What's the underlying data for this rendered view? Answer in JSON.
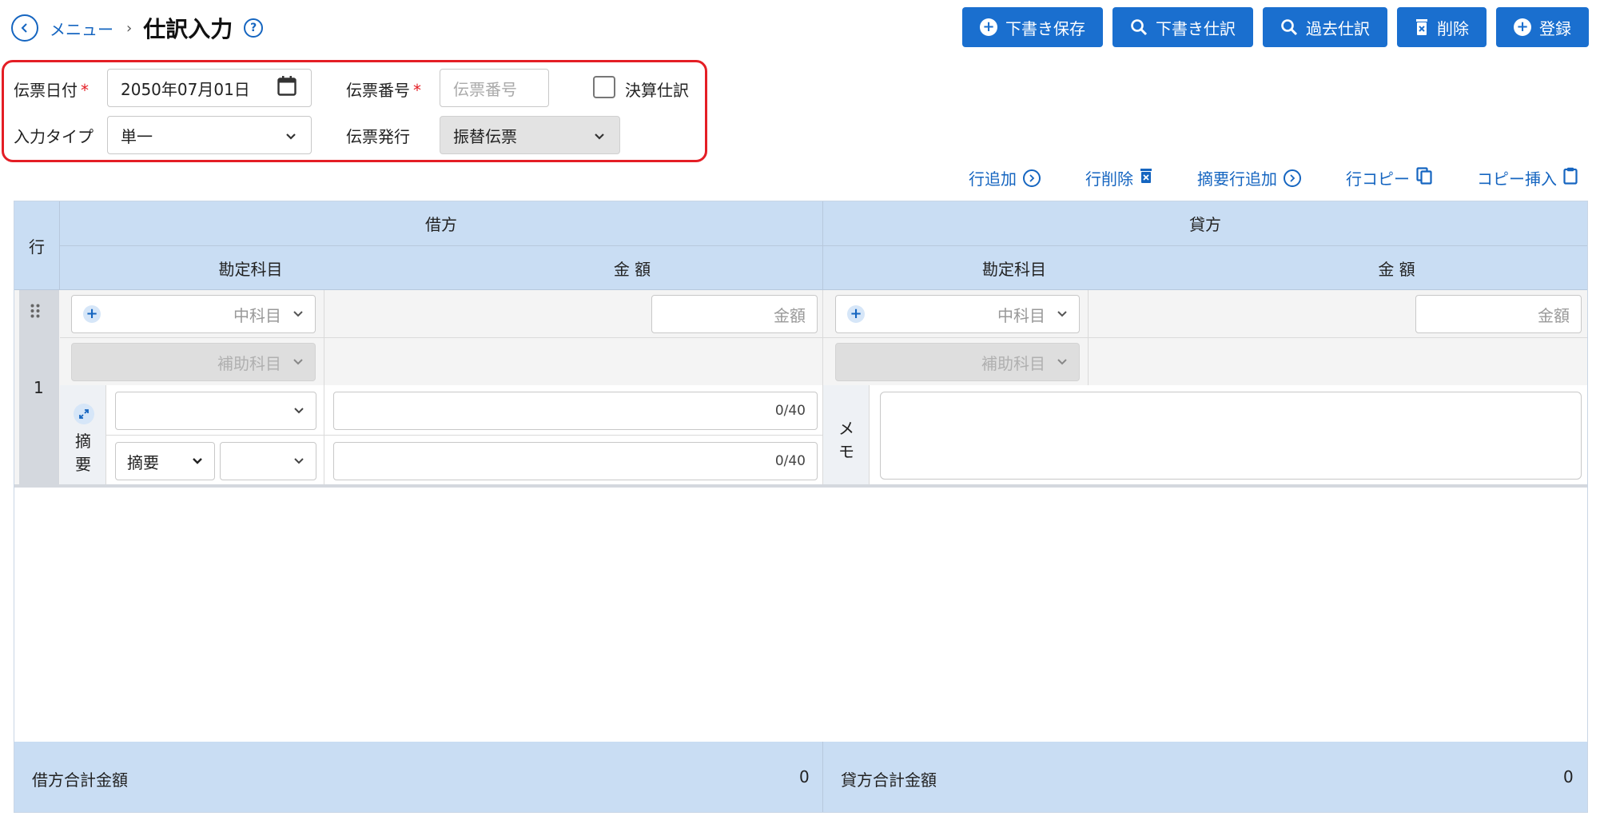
{
  "header": {
    "breadcrumb_menu": "メニュー",
    "breadcrumb_sep": "›",
    "title": "仕訳入力"
  },
  "toolbar": {
    "draft_save": "下書き保存",
    "draft_journal": "下書き仕訳",
    "past_journal": "過去仕訳",
    "delete": "削除",
    "register": "登録"
  },
  "form": {
    "date_label": "伝票日付",
    "date_value": "2050年07月01日",
    "number_label": "伝票番号",
    "number_placeholder": "伝票番号",
    "closing_label": "決算仕訳",
    "closing_checked": false,
    "input_type_label": "入力タイプ",
    "input_type_value": "単一",
    "voucher_issue_label": "伝票発行",
    "voucher_issue_value": "振替伝票",
    "required_mark": "*"
  },
  "row_actions": {
    "add_row": "行追加",
    "delete_row": "行削除",
    "add_summary_row": "摘要行追加",
    "copy_row": "行コピー",
    "copy_insert": "コピー挿入"
  },
  "table": {
    "row_header": "行",
    "debit_header": "借方",
    "credit_header": "貸方",
    "account_header": "勘定科目",
    "amount_header": "金 額",
    "row_number": "1",
    "sub_account_placeholder": "中科目",
    "aux_account_placeholder": "補助科目",
    "amount_placeholder": "金額",
    "summary_label_1": "摘",
    "summary_label_2": "要",
    "summary_select": "摘要",
    "memo_label_1": "メ",
    "memo_label_2": "モ",
    "char_count": "0/40"
  },
  "footer": {
    "debit_total_label": "借方合計金額",
    "debit_total_value": "0",
    "credit_total_label": "貸方合計金額",
    "credit_total_value": "0"
  },
  "colors": {
    "primary": "#1a6fcf",
    "link": "#1565c0",
    "highlight_border": "#e41e25",
    "table_header_bg": "#c9ddf3"
  }
}
